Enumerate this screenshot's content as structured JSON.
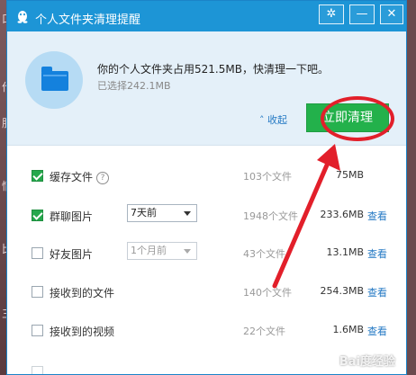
{
  "background": {
    "side_chars": [
      "口",
      "作",
      "肤",
      "情",
      "比",
      "三"
    ]
  },
  "window": {
    "title": "个人文件夹清理提醒",
    "settings_icon": "gear-icon",
    "minimize_icon": "minimize-icon",
    "close_icon": "close-icon"
  },
  "header": {
    "message": "你的个人文件夹占用521.5MB，快清理一下吧。",
    "selected": "已选择242.1MB",
    "collapse_label": "收起",
    "clean_button": "立即清理"
  },
  "rows": [
    {
      "checked": true,
      "label": "缓存文件",
      "help": "?",
      "count": "103个文件",
      "size": "75MB",
      "view": ""
    },
    {
      "checked": true,
      "label": "群聊图片",
      "select": "7天前",
      "count": "1948个文件",
      "size": "233.6MB",
      "view": "查看"
    },
    {
      "checked": false,
      "label": "好友图片",
      "select": "1个月前",
      "count": "43个文件",
      "size": "13.1MB",
      "view": "查看"
    },
    {
      "checked": false,
      "label": "接收到的文件",
      "count": "140个文件",
      "size": "254.3MB",
      "view": "查看"
    },
    {
      "checked": false,
      "label": "接收到的视频",
      "count": "22个文件",
      "size": "1.6MB",
      "view": "查看"
    }
  ],
  "watermark": "Bai度经验",
  "colors": {
    "titlebar": "#1d95d6",
    "clean_button": "#23b14b",
    "annotation_red": "#e21f2a",
    "link": "#2479c4"
  }
}
